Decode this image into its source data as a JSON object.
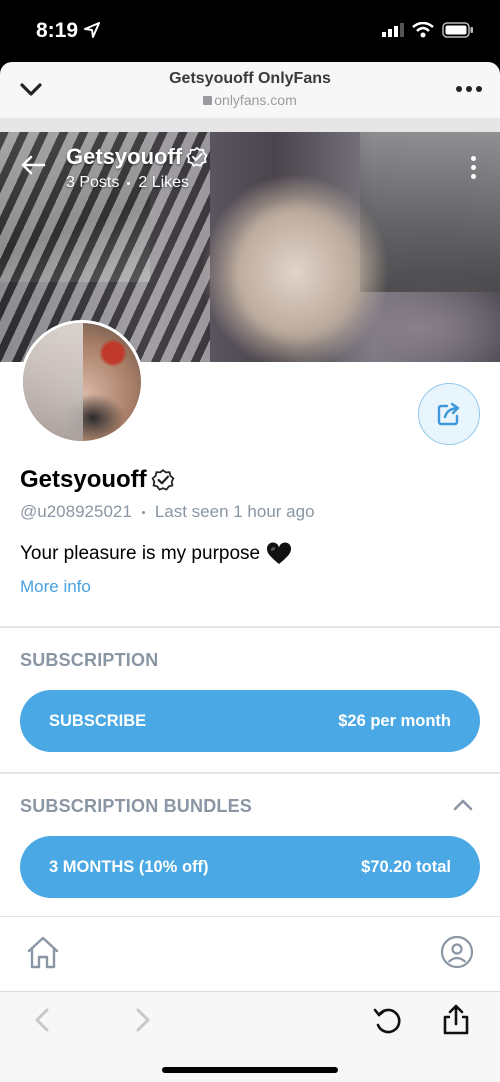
{
  "status_bar": {
    "time": "8:19"
  },
  "browser": {
    "title": "Getsyouoff OnlyFans",
    "url": "onlyfans.com"
  },
  "cover": {
    "name": "Getsyouoff",
    "posts": "3 Posts",
    "likes": "2 Likes"
  },
  "profile": {
    "name": "Getsyouoff",
    "handle": "@u208925021",
    "last_seen": "Last seen 1 hour ago",
    "bio": "Your pleasure is my purpose",
    "bio_emoji": "🖤",
    "more_info": "More info"
  },
  "subscription": {
    "title": "SUBSCRIPTION",
    "button_label": "SUBSCRIBE",
    "button_price": "$26 per month"
  },
  "bundles": {
    "title": "SUBSCRIPTION BUNDLES",
    "items": [
      {
        "label": "3 MONTHS (10% off)",
        "price": "$70.20 total"
      }
    ]
  },
  "colors": {
    "accent": "#4aa8e5",
    "muted": "#8a96a3",
    "link": "#4ba2df"
  },
  "icons": [
    "location-arrow-icon",
    "signal-icon",
    "wifi-icon",
    "battery-icon",
    "chevron-down-icon",
    "more-icon",
    "back-arrow-icon",
    "verified-icon",
    "kebab-icon",
    "share-icon",
    "chevron-up-icon",
    "home-icon",
    "profile-icon",
    "back-icon",
    "forward-icon",
    "reload-icon",
    "share-upload-icon"
  ]
}
